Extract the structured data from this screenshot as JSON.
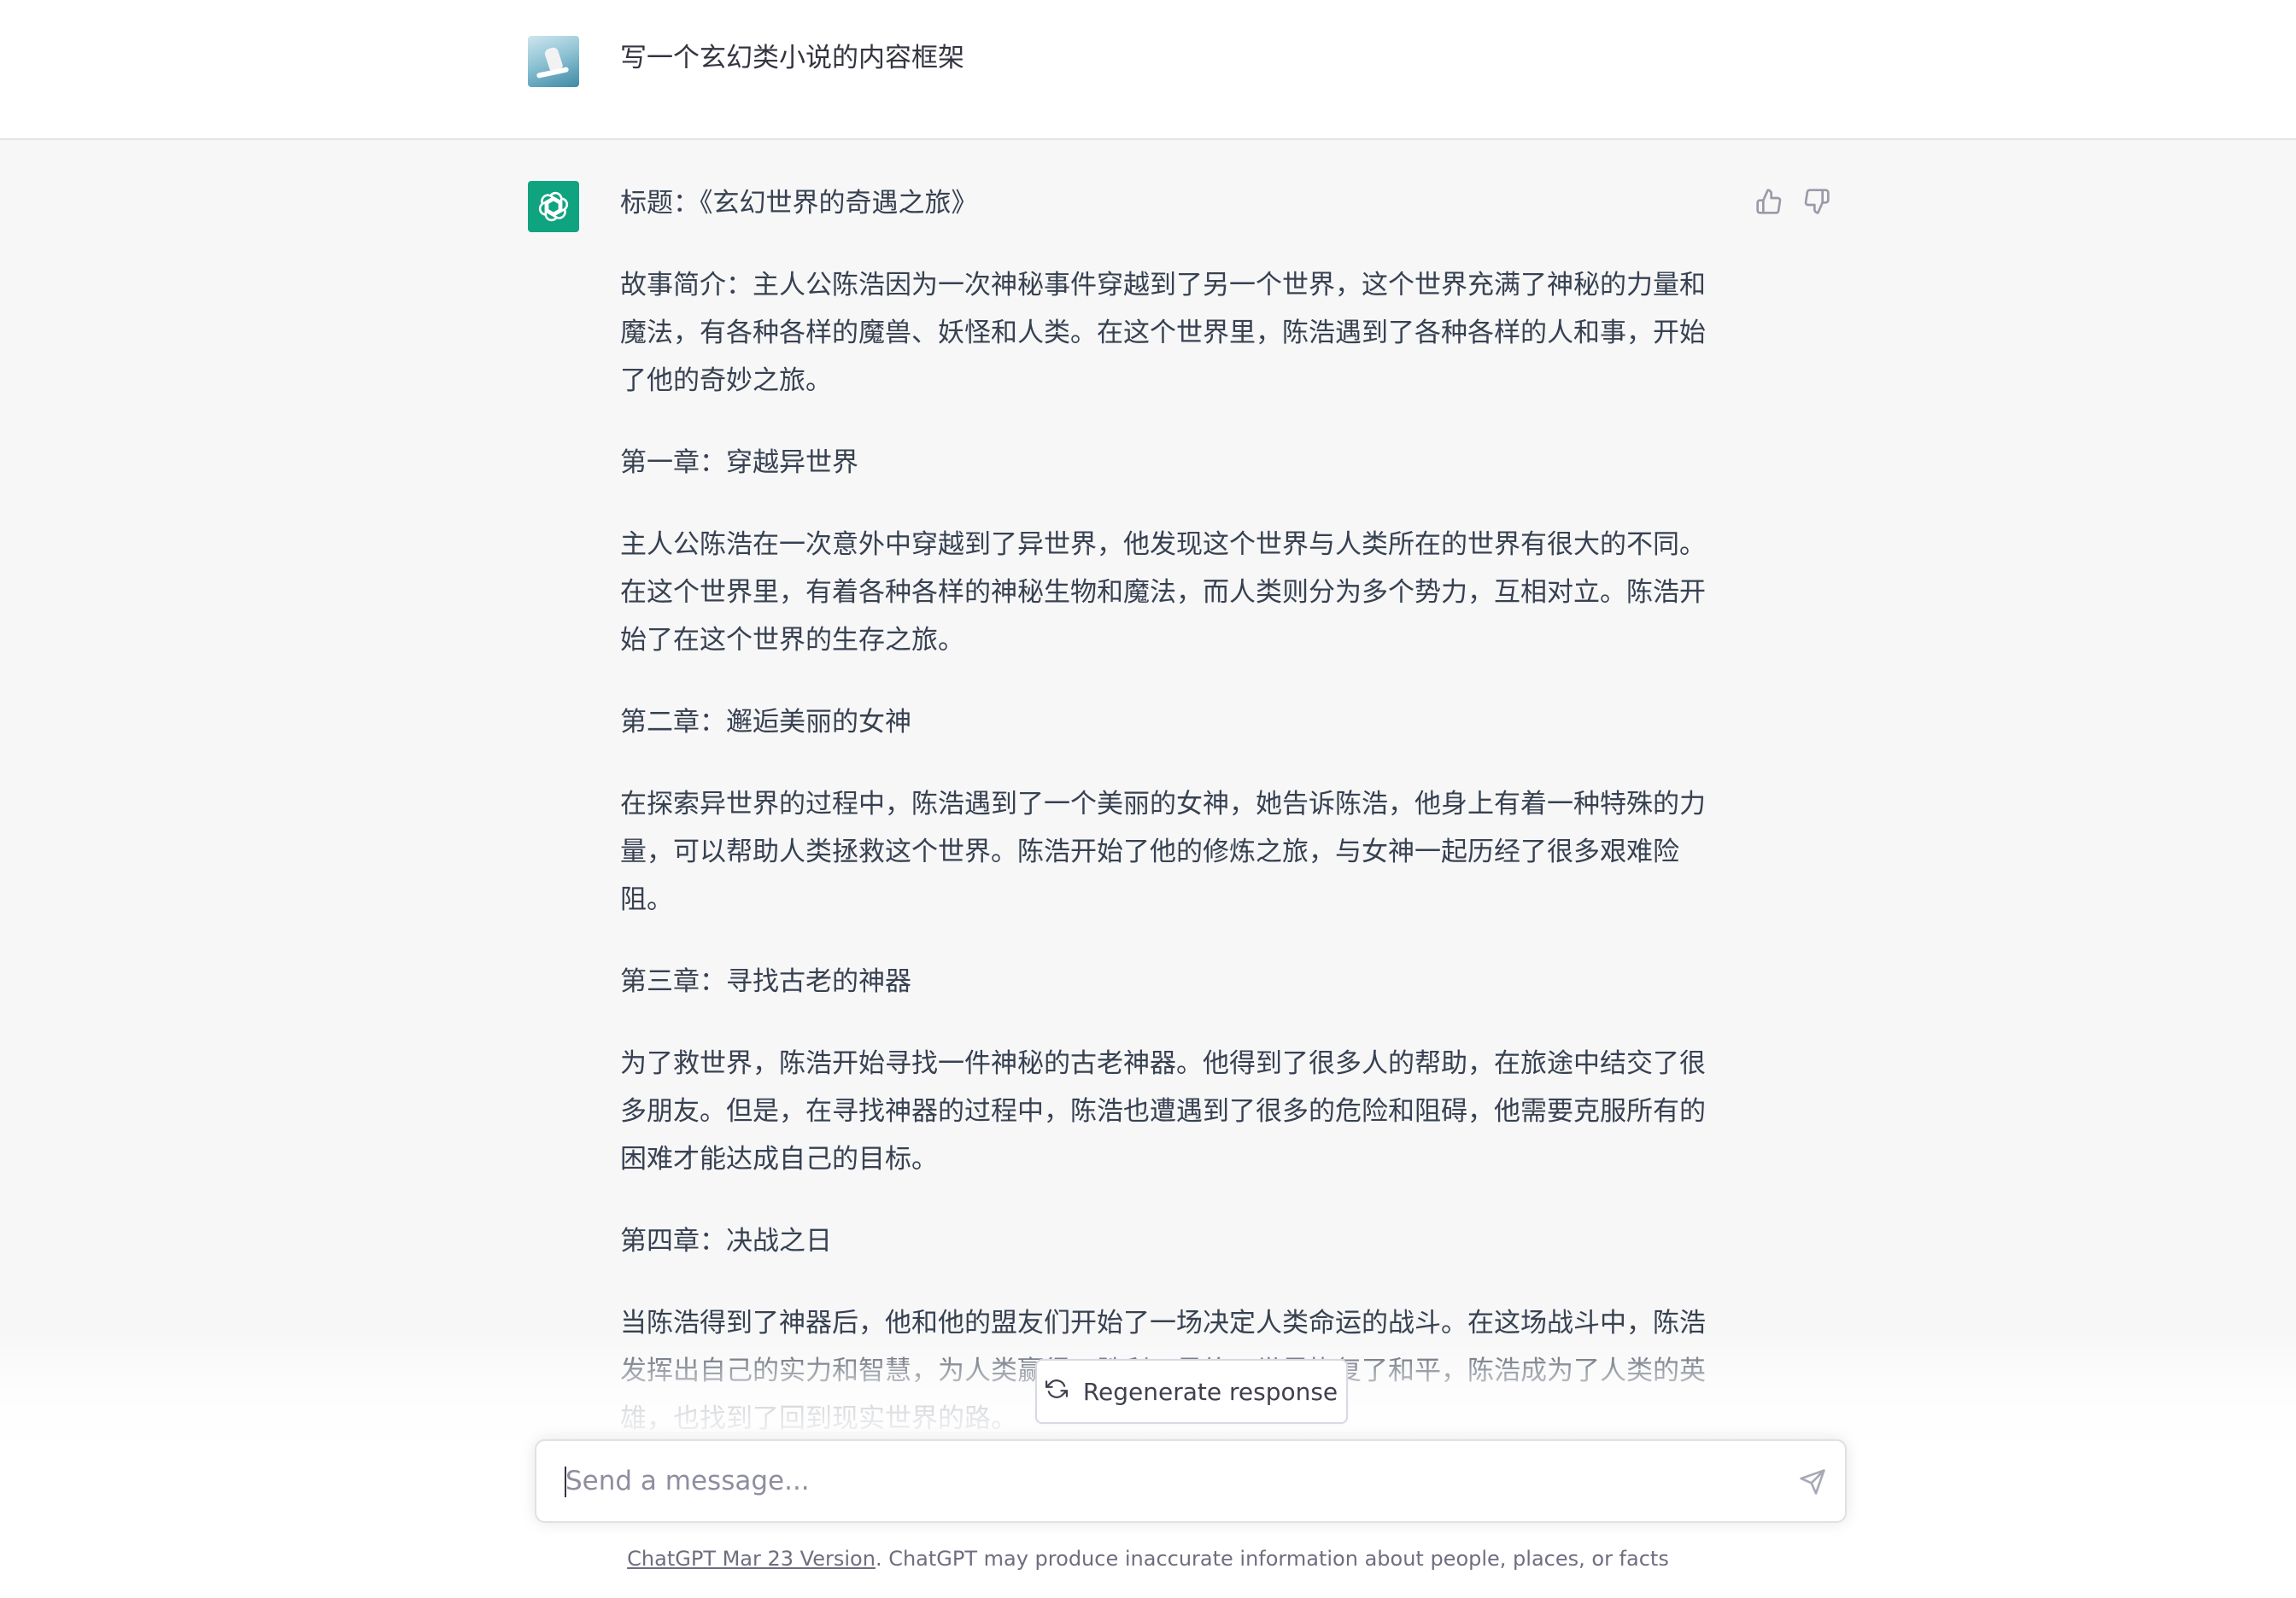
{
  "user_message": {
    "avatar_icon": "user-surfer-avatar",
    "text": "写一个玄幻类小说的内容框架"
  },
  "assistant_message": {
    "avatar_icon": "openai-logo",
    "paragraphs": [
      "标题：《玄幻世界的奇遇之旅》",
      "故事简介：主人公陈浩因为一次神秘事件穿越到了另一个世界，这个世界充满了神秘的力量和魔法，有各种各样的魔兽、妖怪和人类。在这个世界里，陈浩遇到了各种各样的人和事，开始了他的奇妙之旅。",
      "第一章：穿越异世界",
      "主人公陈浩在一次意外中穿越到了异世界，他发现这个世界与人类所在的世界有很大的不同。在这个世界里，有着各种各样的神秘生物和魔法，而人类则分为多个势力，互相对立。陈浩开始了在这个世界的生存之旅。",
      "第二章：邂逅美丽的女神",
      "在探索异世界的过程中，陈浩遇到了一个美丽的女神，她告诉陈浩，他身上有着一种特殊的力量，可以帮助人类拯救这个世界。陈浩开始了他的修炼之旅，与女神一起历经了很多艰难险阻。",
      "第三章：寻找古老的神器",
      "为了救世界，陈浩开始寻找一件神秘的古老神器。他得到了很多人的帮助，在旅途中结交了很多朋友。但是，在寻找神器的过程中，陈浩也遭遇到了很多的危险和阻碍，他需要克服所有的困难才能达成自己的目标。",
      "第四章：决战之日",
      "当陈浩得到了神器后，他和他的盟友们开始了一场决定人类命运的战斗。在这场战斗中，陈浩发挥出自己的实力和智慧，为人类赢得了胜利。最终，世界恢复了和平，陈浩成为了人类的英雄，也找到了回到现实世界的路。"
    ],
    "feedback": {
      "thumbs_up_icon": "thumbs-up-icon",
      "thumbs_down_icon": "thumbs-down-icon"
    }
  },
  "composer": {
    "regenerate_label": "Regenerate response",
    "regenerate_icon": "refresh-icon",
    "placeholder": "Send a message...",
    "value": "",
    "send_icon": "send-icon"
  },
  "footer": {
    "version_link": "ChatGPT Mar 23 Version",
    "disclaimer": ". ChatGPT may produce inaccurate information about people, places, or facts"
  },
  "colors": {
    "brand": "#10a37f",
    "text": "#374151",
    "muted": "#6e6e80",
    "assistant_bg": "#f7f7f8"
  }
}
